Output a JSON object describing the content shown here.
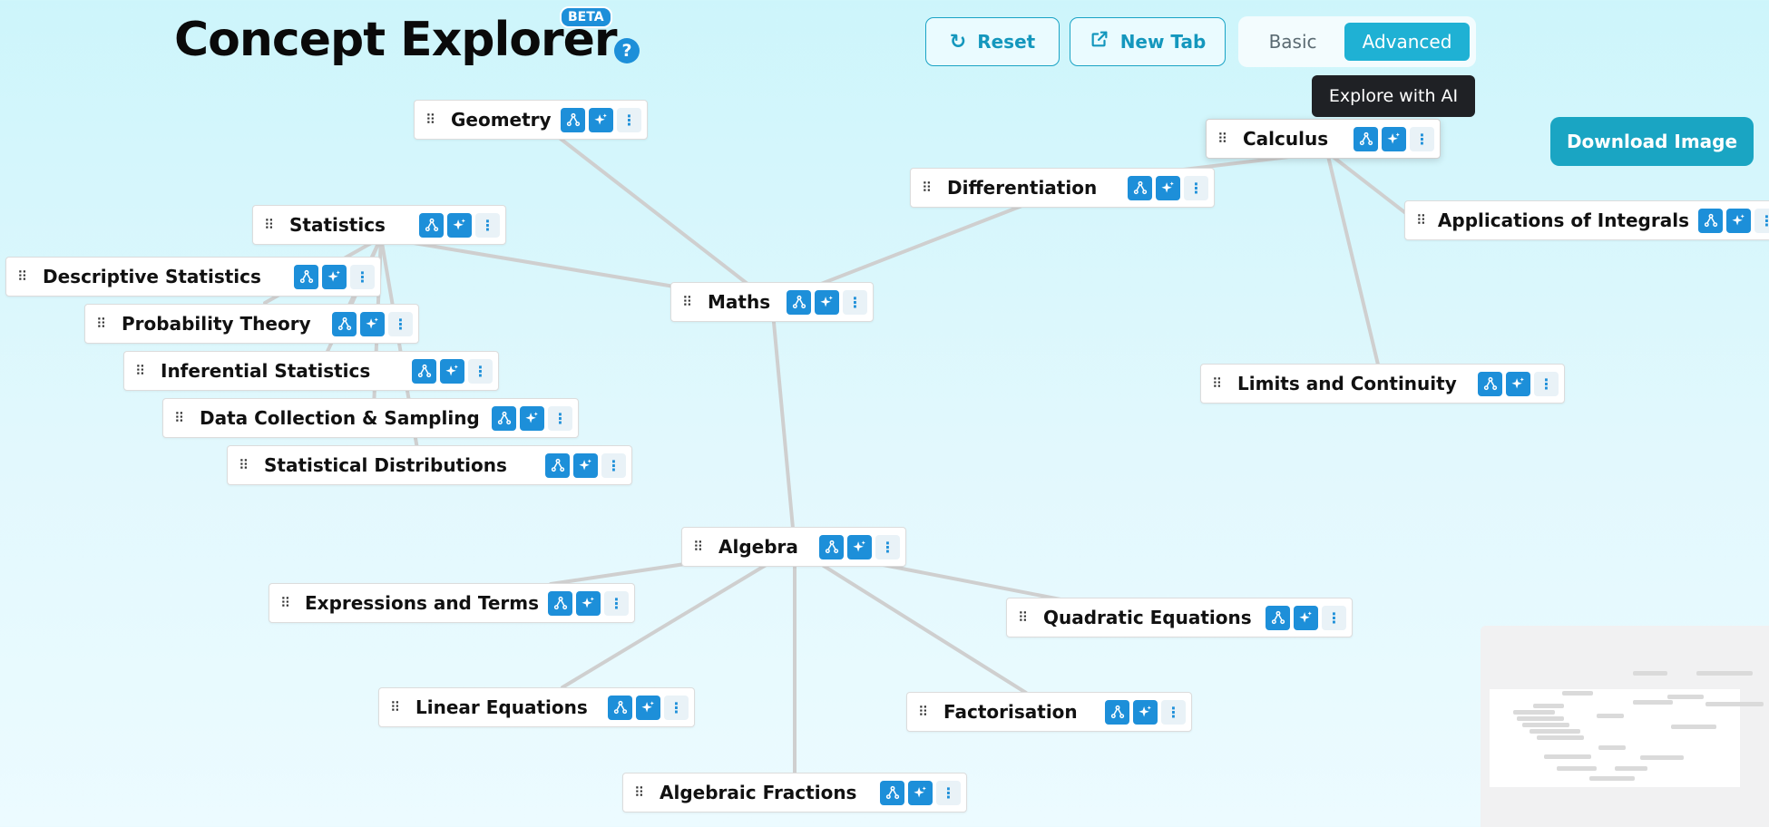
{
  "app": {
    "title": "Concept Explorer",
    "beta_label": "BETA",
    "help_label": "?"
  },
  "toolbar": {
    "reset_label": "Reset",
    "newtab_label": "New Tab",
    "mode_basic": "Basic",
    "mode_advanced": "Advanced",
    "active_mode": "Advanced",
    "tooltip": "Explore with AI",
    "download_label": "Download Image"
  },
  "colors": {
    "accent": "#1d8fd9",
    "teal": "#1aa5c3",
    "edge": "#cfcfcf"
  },
  "nodes": [
    {
      "id": "geometry",
      "label": "Geometry"
    },
    {
      "id": "calculus",
      "label": "Calculus"
    },
    {
      "id": "differentiation",
      "label": "Differentiation"
    },
    {
      "id": "applications-of-integrals",
      "label": "Applications of Integrals"
    },
    {
      "id": "statistics",
      "label": "Statistics"
    },
    {
      "id": "descriptive-statistics",
      "label": "Descriptive Statistics"
    },
    {
      "id": "maths",
      "label": "Maths"
    },
    {
      "id": "probability-theory",
      "label": "Probability Theory"
    },
    {
      "id": "inferential-statistics",
      "label": "Inferential Statistics"
    },
    {
      "id": "limits-and-continuity",
      "label": "Limits and Continuity"
    },
    {
      "id": "data-collection-sampling",
      "label": "Data Collection & Sampling"
    },
    {
      "id": "statistical-distributions",
      "label": "Statistical Distributions"
    },
    {
      "id": "algebra",
      "label": "Algebra"
    },
    {
      "id": "expressions-and-terms",
      "label": "Expressions and Terms"
    },
    {
      "id": "quadratic-equations",
      "label": "Quadratic Equations"
    },
    {
      "id": "linear-equations",
      "label": "Linear Equations"
    },
    {
      "id": "factorisation",
      "label": "Factorisation"
    },
    {
      "id": "algebraic-fractions",
      "label": "Algebraic Fractions"
    }
  ],
  "edges": [
    [
      "maths",
      "geometry"
    ],
    [
      "maths",
      "statistics"
    ],
    [
      "maths",
      "differentiation"
    ],
    [
      "maths",
      "algebra"
    ],
    [
      "differentiation",
      "calculus"
    ],
    [
      "calculus",
      "applications-of-integrals"
    ],
    [
      "calculus",
      "limits-and-continuity"
    ],
    [
      "statistics",
      "descriptive-statistics"
    ],
    [
      "statistics",
      "probability-theory"
    ],
    [
      "statistics",
      "inferential-statistics"
    ],
    [
      "statistics",
      "data-collection-sampling"
    ],
    [
      "statistics",
      "statistical-distributions"
    ],
    [
      "algebra",
      "expressions-and-terms"
    ],
    [
      "algebra",
      "quadratic-equations"
    ],
    [
      "algebra",
      "linear-equations"
    ],
    [
      "algebra",
      "factorisation"
    ],
    [
      "algebra",
      "algebraic-fractions"
    ]
  ],
  "icons": {
    "expand": "tree-icon",
    "ai": "sparkle-icon",
    "more": "more-vertical-icon",
    "grip": "drag-handle-icon"
  }
}
